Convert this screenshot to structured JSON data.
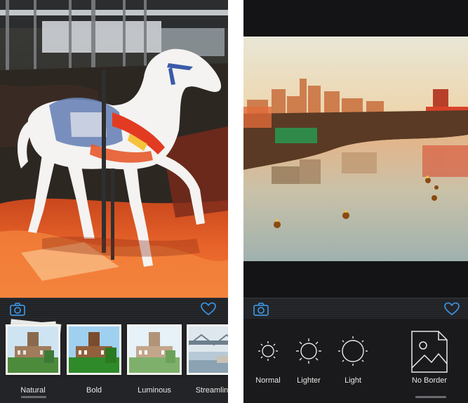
{
  "left_screen": {
    "photo": {
      "subject": "watercolor carousel horse"
    },
    "action_bar": {
      "left_icon": "camera-icon",
      "right_icon": "heart-icon",
      "icon_color": "#3a8fd9"
    },
    "filters": [
      {
        "label": "Natural",
        "selected": true
      },
      {
        "label": "Bold",
        "selected": false
      },
      {
        "label": "Luminous",
        "selected": false
      },
      {
        "label": "Streamline",
        "selected": false
      }
    ]
  },
  "right_screen": {
    "photo": {
      "subject": "watercolor city river at dusk"
    },
    "action_bar": {
      "left_icon": "camera-icon",
      "right_icon": "heart-icon",
      "icon_color": "#3a8fd9"
    },
    "options": [
      {
        "label": "Normal",
        "icon": "sun-small-icon"
      },
      {
        "label": "Lighter",
        "icon": "sun-medium-icon"
      },
      {
        "label": "Light",
        "icon": "sun-large-icon"
      },
      {
        "label": "No Border",
        "icon": "photo-no-border-icon",
        "selected": true
      }
    ]
  }
}
